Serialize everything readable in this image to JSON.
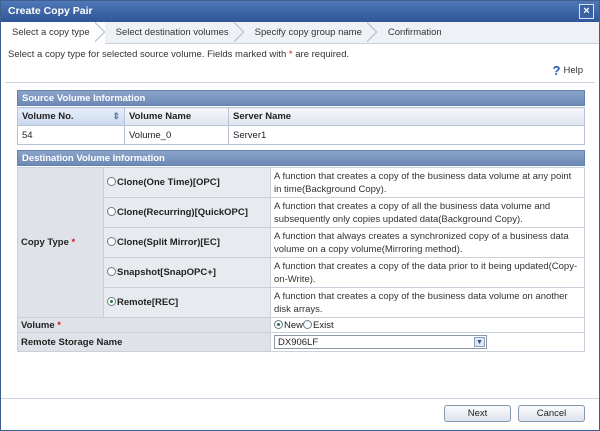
{
  "window": {
    "title": "Create Copy Pair",
    "close": "×"
  },
  "steps": [
    "Select a copy type",
    "Select destination volumes",
    "Specify copy group name",
    "Confirmation"
  ],
  "instruction": {
    "text1": "Select a copy type for selected source volume. Fields marked with",
    "star": "*",
    "text2": "are required."
  },
  "help": {
    "icon": "?",
    "label": "Help"
  },
  "source": {
    "title": "Source Volume Information",
    "columns": [
      "Volume No.",
      "Volume Name",
      "Server Name"
    ],
    "sort_icon": "⇕",
    "rows": [
      [
        "54",
        "Volume_0",
        "Server1"
      ]
    ]
  },
  "destination": {
    "title": "Destination Volume Information",
    "copy_type_label": "Copy Type",
    "star": "*",
    "options": [
      {
        "label": "Clone(One Time)[OPC]",
        "desc": "A function that creates a copy of the business data volume at any point in time(Background Copy).",
        "selected": false
      },
      {
        "label": "Clone(Recurring)[QuickOPC]",
        "desc": "A function that creates a copy of all the business data volume and subsequently only copies updated data(Background Copy).",
        "selected": false
      },
      {
        "label": "Clone(Split Mirror)[EC]",
        "desc": "A function that always creates a synchronized copy of a business data volume on a copy volume(Mirroring method).",
        "selected": false
      },
      {
        "label": "Snapshot[SnapOPC+]",
        "desc": "A function that creates a copy of the data prior to it being updated(Copy-on-Write).",
        "selected": false
      },
      {
        "label": "Remote[REC]",
        "desc": "A function that creates a copy of the business data volume on another disk arrays.",
        "selected": true
      }
    ],
    "volume_label": "Volume",
    "volume_options": [
      "New",
      "Exist"
    ],
    "volume_selected": "New",
    "remote_label": "Remote Storage Name",
    "remote_value": "DX906LF",
    "dropdown_icon": "▼"
  },
  "buttons": {
    "next": "Next",
    "cancel": "Cancel"
  }
}
